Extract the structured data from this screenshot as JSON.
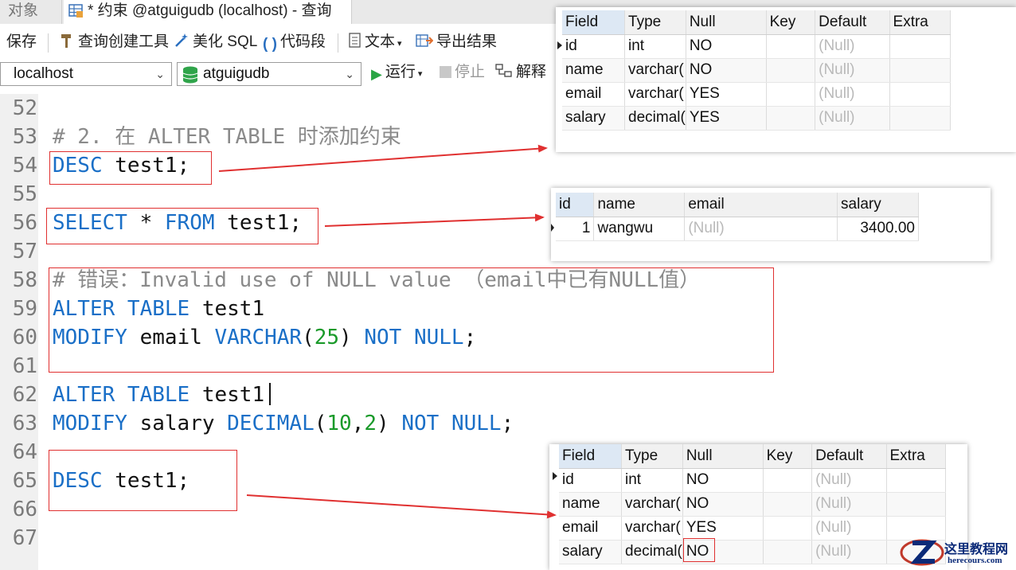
{
  "tabs": {
    "objects_label": "对象",
    "query_label": "* 约束 @atguigudb (localhost) - 查询"
  },
  "toolbar": {
    "save": "保存",
    "query_builder": "查询创建工具",
    "beautify": "美化 SQL",
    "snippet": "代码段",
    "text": "文本",
    "export": "导出结果",
    "run": "运行",
    "stop": "停止",
    "explain": "解释"
  },
  "connection": {
    "host": "localhost",
    "database": "atguigudb"
  },
  "editor": {
    "lines": [
      {
        "n": "52"
      },
      {
        "n": "53",
        "comment": "# 2. 在 ALTER TABLE 时添加约束"
      },
      {
        "n": "54",
        "kw1": "DESC",
        "rest": " test1;"
      },
      {
        "n": "55"
      },
      {
        "n": "56",
        "kw1": "SELECT",
        "mid": " * ",
        "kw2": "FROM",
        "rest": " test1;"
      },
      {
        "n": "57"
      },
      {
        "n": "58",
        "comment": "# 错误：Invalid use of NULL value （email中已有NULL值）"
      },
      {
        "n": "59",
        "kw1": "ALTER TABLE",
        "rest": " test1"
      },
      {
        "n": "60",
        "kw1": "MODIFY",
        "mid": " email ",
        "kw2": "VARCHAR",
        "p1": "(",
        "num1": "25",
        "p2": ") ",
        "kw3": "NOT NULL",
        "rest": ";"
      },
      {
        "n": "61"
      },
      {
        "n": "62",
        "kw1": "ALTER TABLE",
        "rest": " test1"
      },
      {
        "n": "63",
        "kw1": "MODIFY",
        "mid": " salary ",
        "kw2": "DECIMAL",
        "p1": "(",
        "num1": "10",
        "comma": ",",
        "num2": "2",
        "p2": ") ",
        "kw3": "NOT NULL",
        "rest": ";"
      },
      {
        "n": "64"
      },
      {
        "n": "65",
        "kw1": "DESC",
        "rest": " test1;"
      },
      {
        "n": "66"
      },
      {
        "n": "67"
      }
    ]
  },
  "desc_before": {
    "headers": [
      "Field",
      "Type",
      "Null",
      "Key",
      "Default",
      "Extra"
    ],
    "rows": [
      [
        "id",
        "int",
        "NO",
        "",
        "(Null)",
        ""
      ],
      [
        "name",
        "varchar(",
        "NO",
        "",
        "(Null)",
        ""
      ],
      [
        "email",
        "varchar(",
        "YES",
        "",
        "(Null)",
        ""
      ],
      [
        "salary",
        "decimal(",
        "YES",
        "",
        "(Null)",
        ""
      ]
    ]
  },
  "select_result": {
    "headers": [
      "id",
      "name",
      "email",
      "salary"
    ],
    "rows": [
      [
        "1",
        "wangwu",
        "(Null)",
        "3400.00"
      ]
    ]
  },
  "desc_after": {
    "headers": [
      "Field",
      "Type",
      "Null",
      "Key",
      "Default",
      "Extra"
    ],
    "rows": [
      [
        "id",
        "int",
        "NO",
        "",
        "(Null)",
        ""
      ],
      [
        "name",
        "varchar(",
        "NO",
        "",
        "(Null)",
        ""
      ],
      [
        "email",
        "varchar(",
        "YES",
        "",
        "(Null)",
        ""
      ],
      [
        "salary",
        "decimal(",
        "NO",
        "",
        "(Null)",
        ""
      ]
    ]
  },
  "watermark": {
    "title": "这里教程网",
    "url": "herecours.com"
  },
  "colors": {
    "keyword": "#1a6fc7",
    "comment": "#8a8a8a",
    "number": "#1a9a2a",
    "annotation_red": "#e03030"
  }
}
